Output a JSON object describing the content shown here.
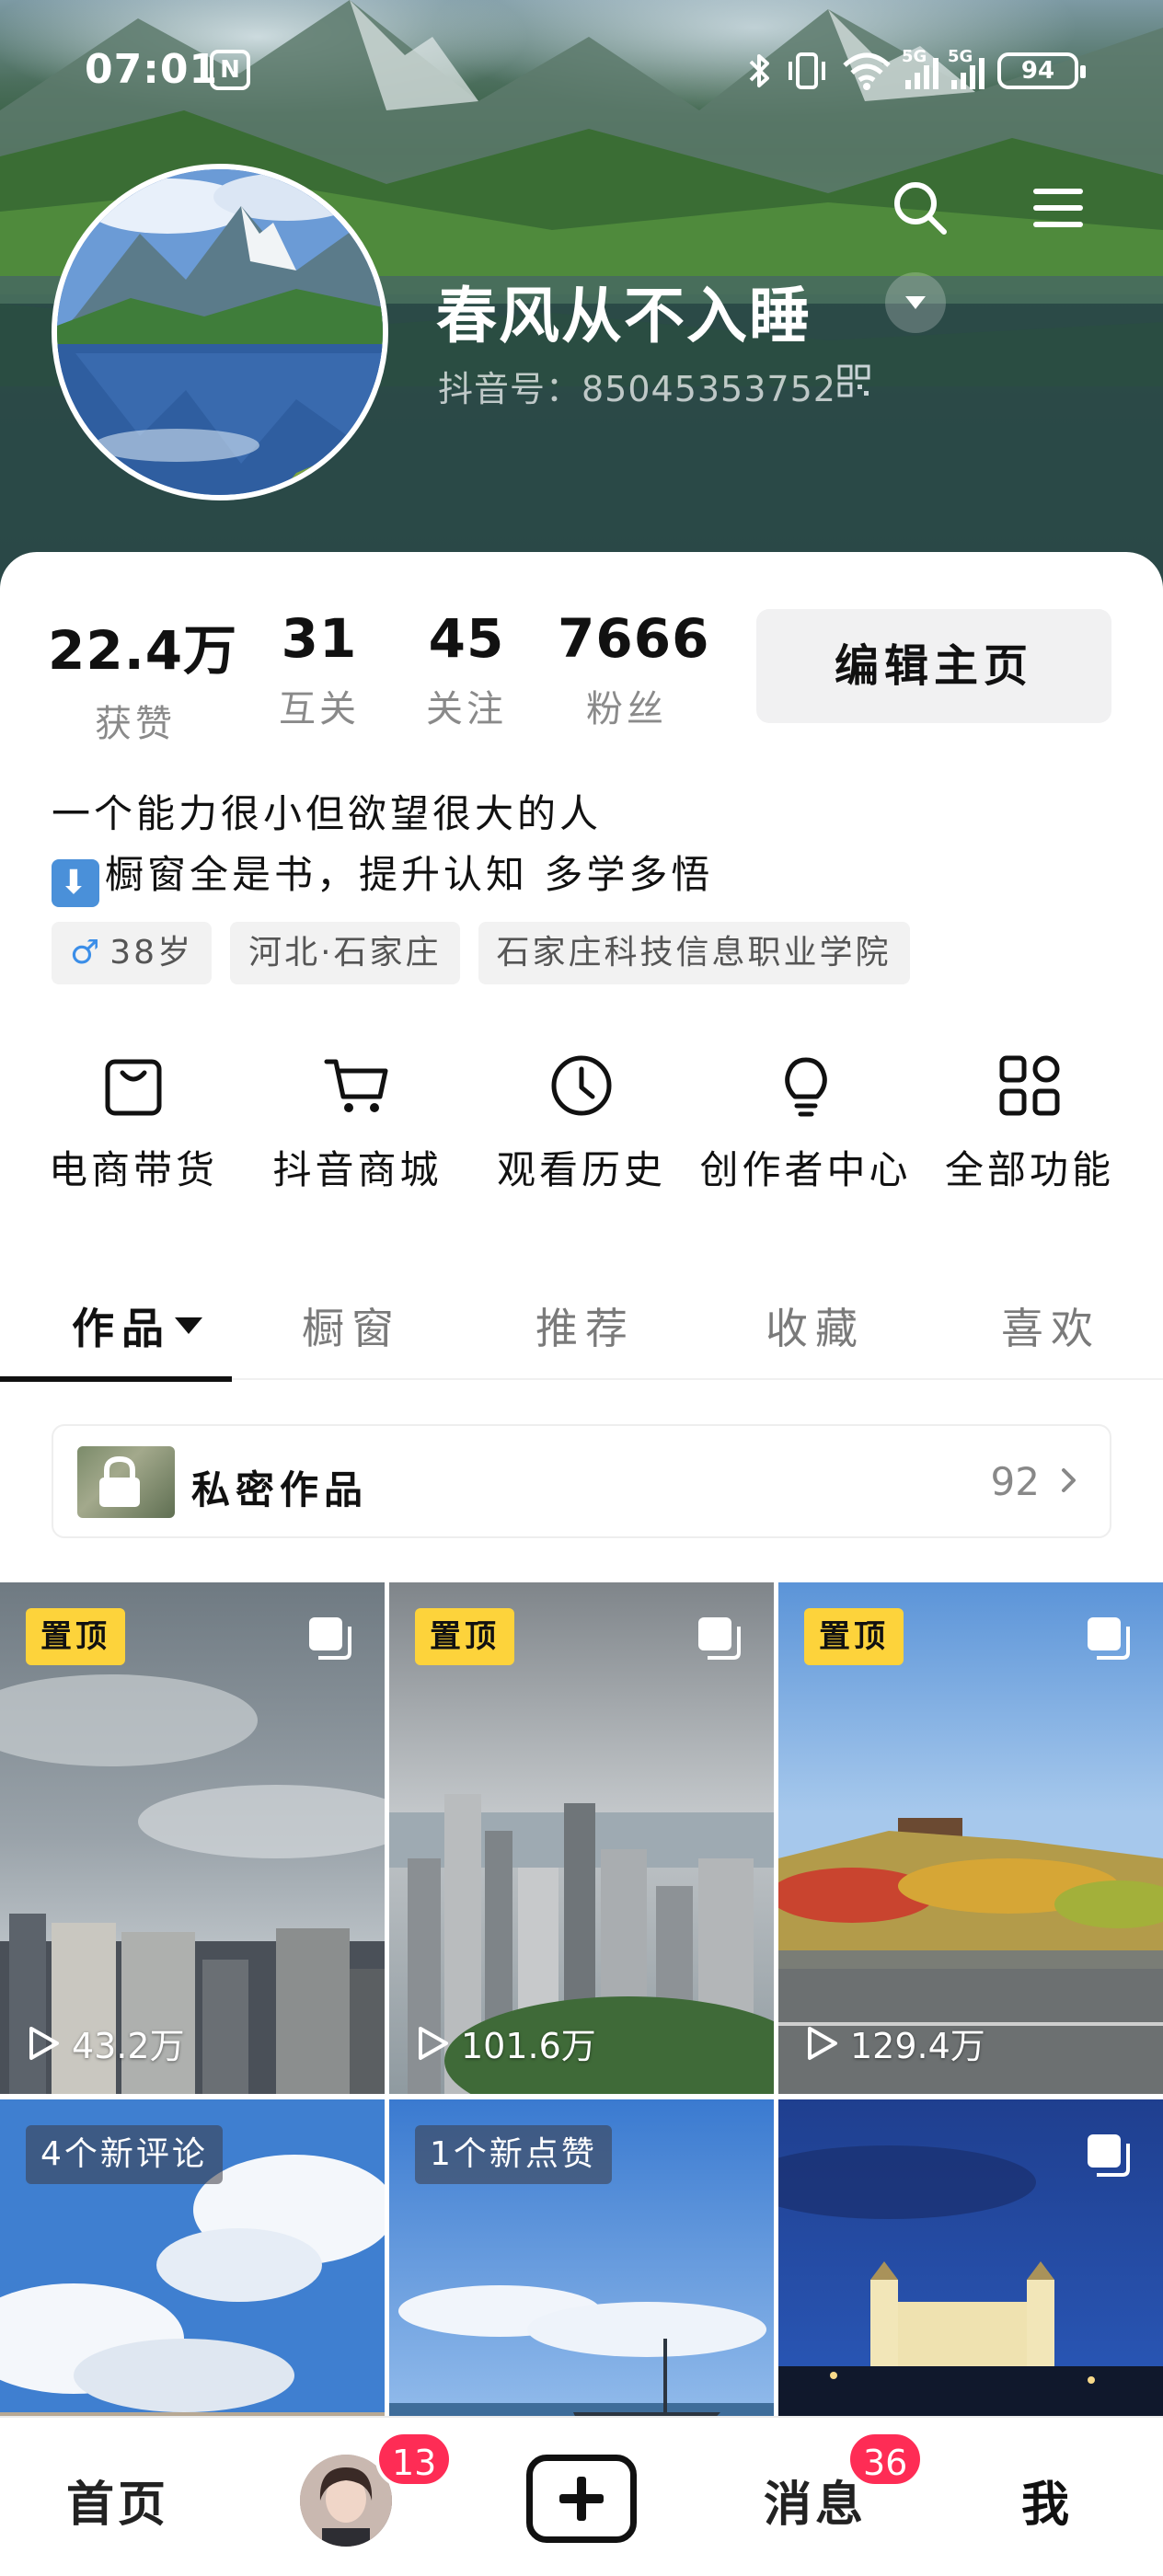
{
  "status_bar": {
    "time": "07:01",
    "nfc_label": "N",
    "signal_1_label": "5G",
    "signal_2_label": "5G",
    "battery": "94"
  },
  "profile": {
    "username": "春风从不入睡",
    "douyin_id": "抖音号：85045353752"
  },
  "stats": [
    {
      "value": "22.4万",
      "label": "获赞"
    },
    {
      "value": "31",
      "label": "互关"
    },
    {
      "value": "45",
      "label": "关注"
    },
    {
      "value": "7666",
      "label": "粉丝"
    }
  ],
  "edit_button": "编辑主页",
  "bio": {
    "line1": "一个能力很小但欲望很大的人",
    "line2_emoji": "⬇",
    "line2": "橱窗全是书，提升认知 多学多悟"
  },
  "tags": {
    "gender_symbol": "♂",
    "age": "38岁",
    "location": "河北·石家庄",
    "school": "石家庄科技信息职业学院"
  },
  "features": [
    {
      "icon": "shopping-bag-icon",
      "label": "电商带货"
    },
    {
      "icon": "cart-icon",
      "label": "抖音商城"
    },
    {
      "icon": "clock-icon",
      "label": "观看历史"
    },
    {
      "icon": "lightbulb-icon",
      "label": "创作者中心"
    },
    {
      "icon": "grid-apps-icon",
      "label": "全部功能"
    }
  ],
  "tabs": [
    {
      "label": "作品",
      "active": true
    },
    {
      "label": "橱窗"
    },
    {
      "label": "推荐"
    },
    {
      "label": "收藏"
    },
    {
      "label": "喜欢"
    }
  ],
  "private_works": {
    "label": "私密作品",
    "count": "92"
  },
  "videos": [
    {
      "badge": "置顶",
      "plays": "43.2万",
      "multi": true,
      "scene": "cloudy-city"
    },
    {
      "badge": "置顶",
      "plays": "101.6万",
      "multi": true,
      "scene": "harbor-skyline"
    },
    {
      "badge": "置顶",
      "plays": "129.4万",
      "multi": true,
      "scene": "autumn-hill-road"
    },
    {
      "notice": "4个新评论",
      "scene": "blue-sky-clouds"
    },
    {
      "notice": "1个新点赞",
      "scene": "sea-boat"
    },
    {
      "multi": true,
      "scene": "night-castle"
    }
  ],
  "bottom_nav": {
    "home": "首页",
    "friends_badge": "13",
    "messages": "消息",
    "messages_badge": "36",
    "me": "我"
  },
  "colors": {
    "accent_red": "#fe2c55",
    "pin_yellow": "#fdd33b",
    "edit_button_bg": "#f1f1f2"
  }
}
